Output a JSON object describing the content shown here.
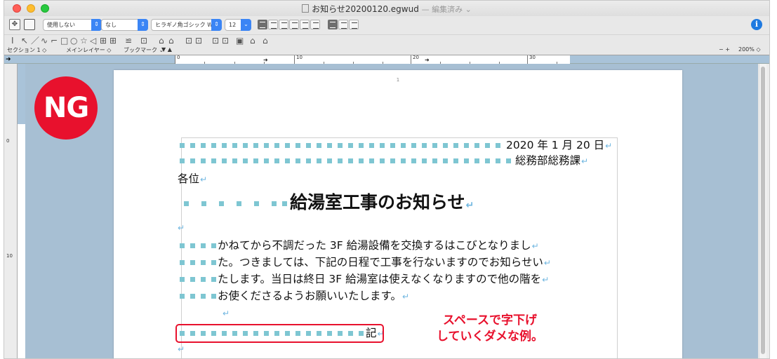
{
  "window": {
    "title": "お知らせ20200120.egwud",
    "title_suffix": "— 編集済み ⌄"
  },
  "toolbar": {
    "style_select": "使用しない",
    "char_style_select": "なし",
    "font_select": "ヒラギノ角ゴシック W3",
    "size_select": "12",
    "info_label": "i"
  },
  "tools": {
    "items": [
      "I",
      "↖",
      "／",
      "∿",
      "⌐",
      "□",
      "○",
      "☆",
      "◁",
      "⊞",
      "⊞",
      "≌",
      "⊡",
      "⌂",
      "⌂",
      "⊡",
      "⊡",
      "⊡",
      "⊡",
      "▣",
      "⌂",
      "⌂"
    ]
  },
  "subbar": {
    "section": "セクション 1 ◇",
    "mainlayer": "メインレイヤー ◇",
    "bookmark": "ブックマーク ⌄",
    "filter": "▼ ▲",
    "zoom_controls": "− +",
    "zoom": "200% ◇"
  },
  "ruler": {
    "marks": [
      "0",
      "10",
      "20",
      "30"
    ],
    "vmarks": [
      "0",
      "10"
    ]
  },
  "document": {
    "page_number": "1",
    "ng_label": "NG",
    "date_line": "2020 年 1 月 20 日",
    "dept_line": "総務部総務課",
    "salutation": "各位",
    "heading": "給湯室工事のお知らせ",
    "body": [
      "かねてから不調だった 3F 給湯設備を交換するはこびとなりまし",
      "た。つきましては、下記の日程で工事を行ないますのでお知らせい",
      "たします。当日は終日 3F 給湯室は使えなくなりますので他の階を",
      "お使くださるようお願いいたします。"
    ],
    "ki_label": "記",
    "return_mark": "↵"
  },
  "annotation": {
    "line1": "スペースで字下げ",
    "line2": "していくダメな例。"
  },
  "colors": {
    "ng_red": "#e8112d",
    "space_marker": "#7ec6d2",
    "paste_board": "#a7bfd3"
  }
}
